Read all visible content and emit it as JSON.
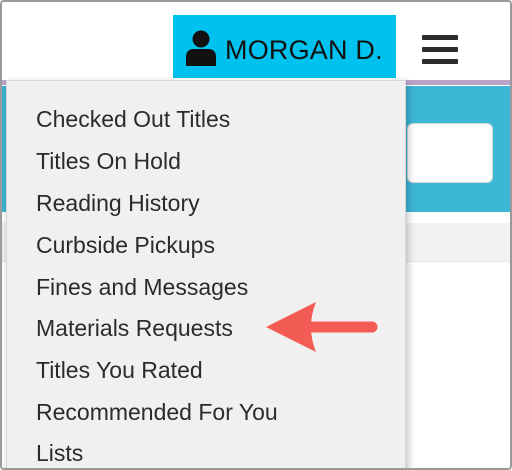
{
  "account": {
    "user_name": "MORGAN D.",
    "icon": "user-icon"
  },
  "header": {
    "menu_icon": "hamburger-icon"
  },
  "menu": {
    "items": [
      {
        "label": "Checked Out Titles"
      },
      {
        "label": "Titles On Hold"
      },
      {
        "label": "Reading History"
      },
      {
        "label": "Curbside Pickups"
      },
      {
        "label": "Fines and Messages"
      },
      {
        "label": "Materials Requests"
      },
      {
        "label": "Titles You Rated"
      },
      {
        "label": "Recommended For You"
      },
      {
        "label": "Lists"
      }
    ]
  },
  "annotation": {
    "highlighted_item": "Materials Requests",
    "arrow_color": "#f25c54",
    "arrow_icon": "arrow-left-icon"
  },
  "colors": {
    "account_button": "#00c2ef",
    "banner": "#3cb7d6",
    "menu_background": "#f0f0f0"
  }
}
